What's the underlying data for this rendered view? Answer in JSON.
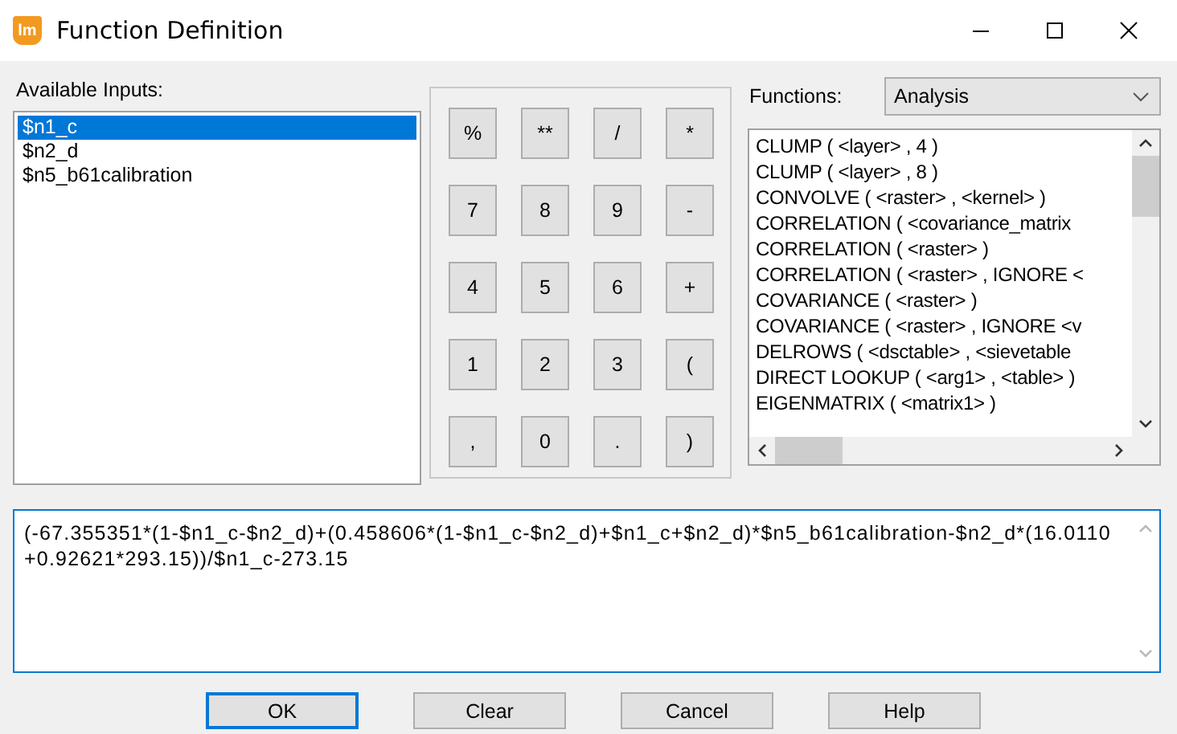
{
  "window": {
    "title": "Function Definition",
    "icon_text": "lm"
  },
  "inputs": {
    "label": "Available Inputs:",
    "items": [
      {
        "label": "$n1_c",
        "selected": true
      },
      {
        "label": "$n2_d",
        "selected": false
      },
      {
        "label": "$n5_b61calibration",
        "selected": false
      }
    ]
  },
  "keypad": [
    "%",
    "**",
    "/",
    "*",
    "7",
    "8",
    "9",
    "-",
    "4",
    "5",
    "6",
    "+",
    "1",
    "2",
    "3",
    "(",
    ",",
    "0",
    ".",
    ")"
  ],
  "functions": {
    "label": "Functions:",
    "category": "Analysis",
    "items": [
      "CLUMP ( <layer> , 4 )",
      "CLUMP ( <layer> , 8 )",
      "CONVOLVE ( <raster> , <kernel> )",
      "CORRELATION ( <covariance_matrix",
      "CORRELATION ( <raster> )",
      "CORRELATION ( <raster> , IGNORE <",
      "COVARIANCE ( <raster> )",
      "COVARIANCE ( <raster> , IGNORE <v",
      "DELROWS ( <dsctable> , <sievetable",
      "DIRECT LOOKUP ( <arg1> , <table> )",
      "EIGENMATRIX ( <matrix1> )"
    ]
  },
  "formula": "(-67.355351*(1-$n1_c-$n2_d)+(0.458606*(1-$n1_c-$n2_d)+$n1_c+$n2_d)*$n5_b61calibration-$n2_d*(16.0110+0.92621*293.15))/$n1_c-273.15",
  "buttons": [
    {
      "label": "OK",
      "default": true
    },
    {
      "label": "Clear",
      "default": false
    },
    {
      "label": "Cancel",
      "default": false
    },
    {
      "label": "Help",
      "default": false
    }
  ]
}
